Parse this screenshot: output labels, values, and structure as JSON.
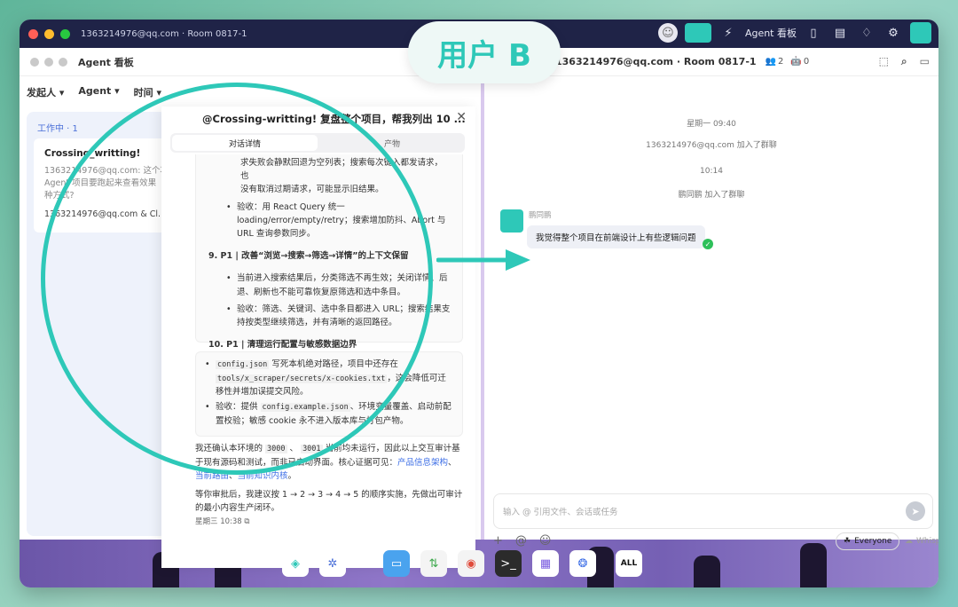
{
  "topbar": {
    "title": "1363214976@qq.com · Room 0817-1",
    "agent_board": "Agent 看板"
  },
  "left": {
    "window_title": "Agent 看板",
    "filters": [
      "发起人 ▾",
      "Agent ▾",
      "时间 ▾"
    ],
    "column_label": "工作中 · 1",
    "card": {
      "title": "Crossing_writting!",
      "line1": "1363214976@qq.com:  这个项",
      "line2": "Agent  项目要跑起来查看效果",
      "line3": "种方式?",
      "members": "1363214976@qq.com & Cl..."
    }
  },
  "panel": {
    "title": "@Crossing-writting! 复盘整个项目，帮我列出 10 ...",
    "close": "✕",
    "tabs": [
      "对话详情",
      "产物"
    ],
    "b1_lines": [
      "求失败会静默回退为空列表；搜索每次键入都发请求，也",
      "没有取消过期请求，可能显示旧结果。"
    ],
    "b1_item": "验收：用 React Query 统一 loading/error/empty/retry；搜索增加防抖、Abort 与 URL 查询参数同步。",
    "s9": "9. P1 | 改善“浏览→搜索→筛选→详情”的上下文保留",
    "s9_a": "当前进入搜索结果后，分类筛选不再生效；关闭详情、后退、刷新也不能可靠恢复原筛选和选中条目。",
    "s9_b": "验收：筛选、关键词、选中条目都进入 URL；搜索结果支持按类型继续筛选，并有清晰的返回路径。",
    "s10": "10. P1 | 清理运行配置与敏感数据边界",
    "b2_code1": "config.json",
    "b2_t1": " 写死本机绝对路径，项目中还存在 ",
    "b2_code2": "tools/x_scraper/secrets/x-cookies.txt",
    "b2_t2": "，这会降低可迁移性并增加误提交风险。",
    "b2_item2_a": "验收：提供 ",
    "b2_code3": "config.example.json",
    "b2_item2_b": "、环境变量覆盖、启动前配置校验；敏感 cookie 永不进入版本库与打包产物。",
    "para1_a": "我还确认本环境的 ",
    "p_code1": "3000",
    "p_sep": " 、 ",
    "p_code2": "3001",
    "para1_b": " 当前均未运行，因此以上交互审计基于现有源码和测试，而非已启动界面。核心证据可见：",
    "link1": "产品信息架构",
    "link_sep": "、",
    "link2": "当前路由",
    "link3": "当前知识内核",
    "para1_c": "。",
    "para2": "等你审批后，我建议按 1 → 2 → 3 → 4 → 5 的顺序实施，先做出可审计的最小内容生产闭环。",
    "time": "星期三 10:38"
  },
  "right": {
    "header": "1363214976@qq.com · Room 0817-1",
    "members": "2",
    "agents": "0",
    "sys1": "星期一 09:40",
    "sys2": "1363214976@qq.com 加入了群聊",
    "sys3": "10:14",
    "sys4": "鹏同鹏 加入了群聊",
    "sender": "鹏同鹏",
    "message": "我觉得整个项目在前端设计上有些逻辑问题",
    "placeholder": "输入 @ 引用文件、会话或任务",
    "everyone": "Everyone",
    "whisper": "Whisper"
  },
  "overlay": {
    "badge": "用户 B"
  },
  "dock": {
    "all": "ALL"
  },
  "colors": {
    "accent": "#2ec8b8",
    "topbar": "#1f2347",
    "link": "#3e6fe6"
  }
}
